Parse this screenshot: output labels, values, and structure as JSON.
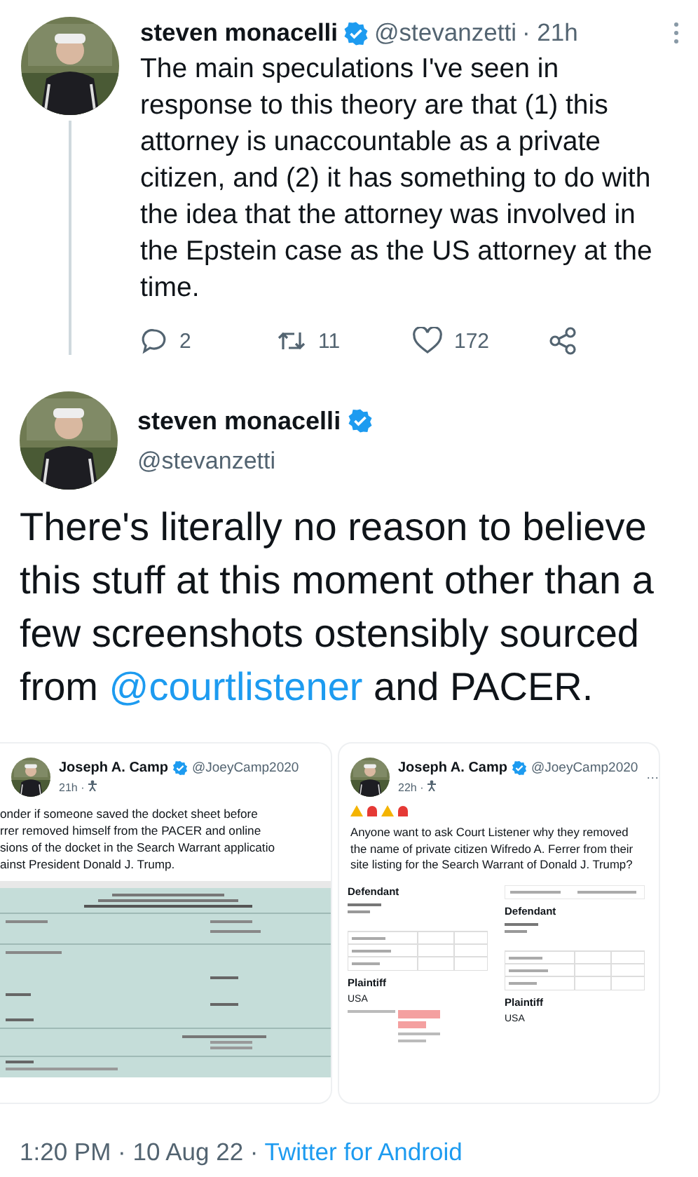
{
  "reply_tweet": {
    "author": {
      "name": "steven monacelli",
      "verified": true,
      "handle": "@stevanzetti",
      "time": "· 21h"
    },
    "text": "The main speculations I've seen in response to this theory are that (1) this attorney is unaccountable as a private citizen, and (2) it has something to do with the idea that the attorney was involved in the Epstein case as the US attorney at the time.",
    "actions": [
      {
        "kind": "reply",
        "count": "2"
      },
      {
        "kind": "retweet",
        "count": "11"
      },
      {
        "kind": "like",
        "count": "172"
      },
      {
        "kind": "share"
      }
    ]
  },
  "main_tweet": {
    "author": {
      "name": "steven monacelli",
      "verified": true,
      "handle": "@stevanzetti"
    },
    "text_before": "There's literally no reason to believe this stuff at this moment other than a few screenshots ostensibly sourced from ",
    "mention": "@courtlistener",
    "text_after": " and PACER.",
    "attached_screenshots": [
      {
        "kind": "docket",
        "name": "Joseph A. Camp",
        "verified": true,
        "handle": "@JoeyCamp2020",
        "time": "21h ·",
        "lines": [
          "onder if someone saved the docket sheet before",
          "rrer removed himself from the PACER and online",
          "sions of the docket in the Search Warrant applicatio",
          "ainst President Donald J. Trump."
        ]
      },
      {
        "kind": "listing",
        "name": "Joseph A. Camp",
        "verified": true,
        "handle": "@JoeyCamp2020",
        "time": "22h ·",
        "more": "···",
        "text": "Anyone want to ask Court Listener why they removed the name of private citizen Wifredo A. Ferrer from their site listing for the Search Warrant of Donald J. Trump?",
        "panels": [
          {
            "defendant": "Defendant",
            "plaintiff": "Plaintiff",
            "party": "USA"
          },
          {
            "defendant": "Defendant",
            "plaintiff": "Plaintiff",
            "party": "USA"
          }
        ]
      }
    ],
    "footer": {
      "time": "1:20 PM · 10 Aug 22 · ",
      "source": "Twitter for Android"
    }
  }
}
